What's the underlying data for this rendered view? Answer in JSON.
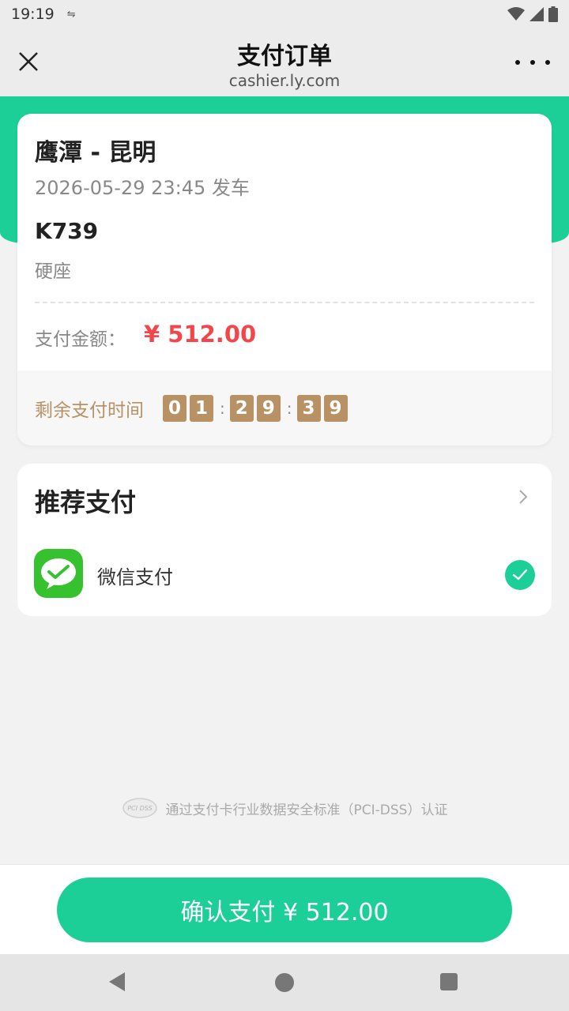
{
  "status_bar": {
    "time": "19:19",
    "notification_icon": "data-saver-icon",
    "icons": [
      "wifi-icon",
      "signal-icon",
      "battery-icon"
    ]
  },
  "header": {
    "title": "支付订单",
    "url": "cashier.ly.com",
    "close_icon": "close-icon",
    "more_icon": "more-icon"
  },
  "order": {
    "route": "鹰潭 - 昆明",
    "departure": "2026-05-29 23:45 发车",
    "train_number": "K739",
    "seat_type": "硬座",
    "amount_label": "支付金额：",
    "amount": "¥ 512.00",
    "countdown_label": "剩余支付时间",
    "countdown": {
      "h1": "0",
      "h2": "1",
      "m1": "2",
      "m2": "9",
      "s1": "3",
      "s2": "9",
      "separator": ":"
    }
  },
  "payment": {
    "section_title": "推荐支付",
    "method_label": "微信支付",
    "selected": true
  },
  "security": {
    "logo_text": "PCI DSS",
    "text": "通过支付卡行业数据安全标准（PCI-DSS）认证"
  },
  "confirm_button": {
    "label": "确认支付 ¥ 512.00"
  },
  "colors": {
    "brand_green": "#1ccf97",
    "price_red": "#f2464b",
    "countdown_gold": "#b89264",
    "wechat_green": "#36c12f"
  }
}
